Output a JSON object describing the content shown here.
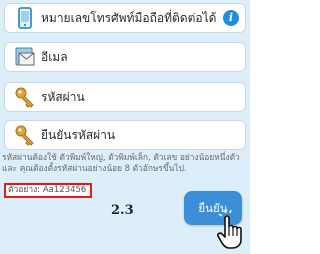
{
  "form": {
    "phone_label": "หมายเลขโทรศัพท์มือถือที่ติดต่อได้",
    "email_label": "อีเมล",
    "password_label": "รหัสผ่าน",
    "confirm_password_label": "ยืนยันรหัสผ่าน",
    "info_symbol": "i"
  },
  "password_hint": "รหัสผ่านต้องใช้ ตัวพิมพ์ใหญ่, ตัวพิมพ์เล็ก, ตัวเลข อย่างน้อยหนึ่งตัว และ คุณต้องตั้งรหัสผ่านอย่างน้อย 8 ตัวอักษรขึ้นไป.",
  "example_text": "ตัวอย่าง: Aa123456",
  "step_number": "2.3",
  "confirm_button": "ยืนยัน",
  "colors": {
    "accent": "#3a8fd6",
    "highlight": "#e21b1b",
    "panel": "#dceef9"
  },
  "icons": [
    "phone-icon",
    "email-icon",
    "key-icon",
    "key-icon",
    "info-icon",
    "hand-cursor-icon"
  ]
}
